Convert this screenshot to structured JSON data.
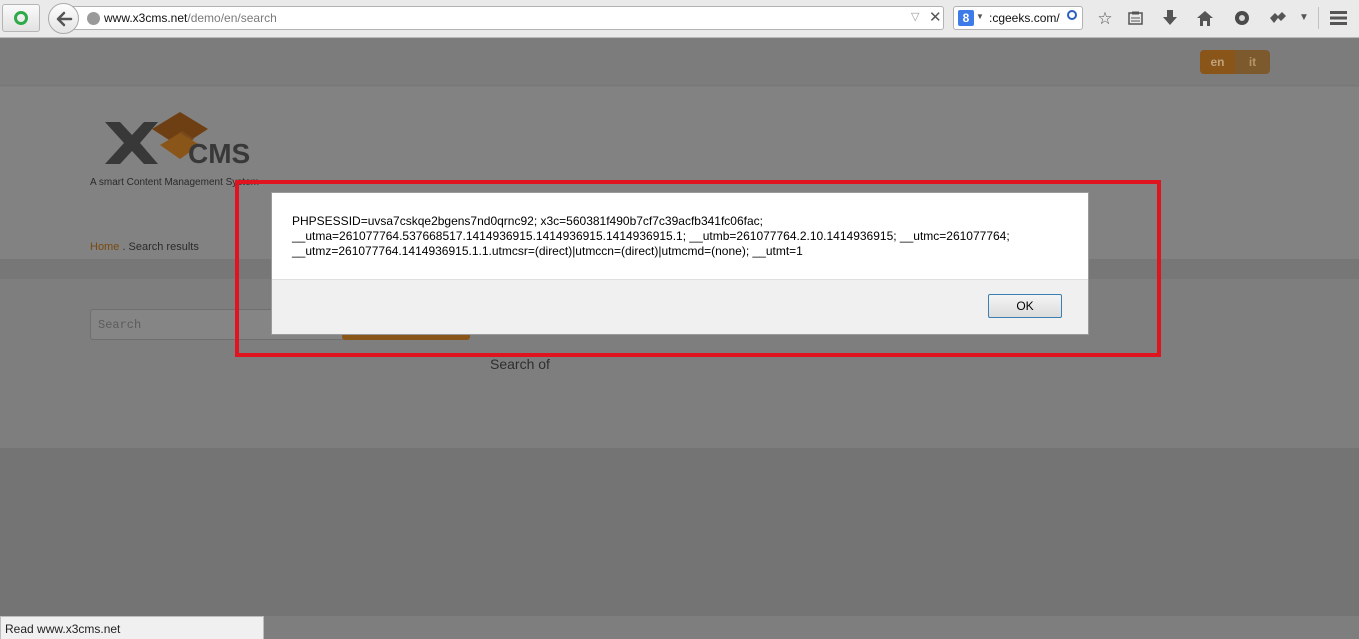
{
  "browser": {
    "url_domain": "www.x3cms.net",
    "url_path": "/demo/en/search",
    "search_text": ":cgeeks.com/",
    "search_engine_letter": "8"
  },
  "site": {
    "lang_en": "en",
    "lang_it": "it",
    "logo_text": "CMS",
    "tagline": "A smart Content Management System",
    "crumb_home": "Home",
    "crumb_sep": " . ",
    "crumb_current": "Search results",
    "search_placeholder": "Search",
    "search_of": "Search of"
  },
  "dialog": {
    "message": "PHPSESSID=uvsa7cskqe2bgens7nd0qrnc92; x3c=560381f490b7cf7c39acfb341fc06fac; __utma=261077764.537668517.1414936915.1414936915.1414936915.1; __utmb=261077764.2.10.1414936915; __utmc=261077764; __utmz=261077764.1414936915.1.1.utmcsr=(direct)|utmccn=(direct)|utmcmd=(none); __utmt=1",
    "ok_label": "OK"
  },
  "status_bar": {
    "text": "Read www.x3cms.net"
  },
  "colors": {
    "highlight": "#e0141e",
    "accent": "#8a5519"
  },
  "icons": [
    "bookmark-star-icon",
    "reading-list-icon",
    "download-icon",
    "home-icon",
    "sync-icon",
    "addon-icon",
    "menu-icon"
  ]
}
